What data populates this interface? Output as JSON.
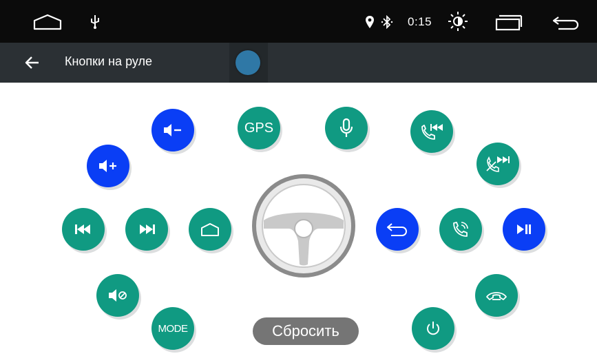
{
  "status_bar": {
    "clock": "0:15",
    "icons": [
      "home-outline-icon",
      "usb-icon",
      "location-pin-icon",
      "bluetooth-icon",
      "brightness-icon",
      "recent-apps-icon",
      "back-return-icon"
    ]
  },
  "app_bar": {
    "title": "Кнопки на руле",
    "back_icon": "arrow-left-icon"
  },
  "buttons": [
    {
      "id": "vol-down",
      "icon": "volume-down-icon",
      "color": "blue"
    },
    {
      "id": "vol-up",
      "icon": "volume-up-icon",
      "color": "blue"
    },
    {
      "id": "gps",
      "label": "GPS",
      "color": "green"
    },
    {
      "id": "mic",
      "icon": "microphone-icon",
      "color": "green"
    },
    {
      "id": "call-prev",
      "icon": "call-previous-icon",
      "color": "green"
    },
    {
      "id": "hangup-next",
      "icon": "hangup-next-icon",
      "color": "green"
    },
    {
      "id": "prev",
      "icon": "skip-previous-icon",
      "color": "green"
    },
    {
      "id": "next",
      "icon": "skip-next-icon",
      "color": "green"
    },
    {
      "id": "home",
      "icon": "home-outline-icon",
      "color": "green"
    },
    {
      "id": "back",
      "icon": "back-return-icon",
      "color": "blue"
    },
    {
      "id": "call",
      "icon": "phone-call-icon",
      "color": "green"
    },
    {
      "id": "play-pause",
      "icon": "play-pause-icon",
      "color": "blue"
    },
    {
      "id": "mute",
      "icon": "mute-icon",
      "color": "green"
    },
    {
      "id": "hangup",
      "icon": "hangup-icon",
      "color": "green"
    },
    {
      "id": "mode",
      "label": "MODE",
      "color": "green"
    },
    {
      "id": "power",
      "icon": "power-icon",
      "color": "green"
    }
  ],
  "reset_label": "Сбросить",
  "colors": {
    "green": "#109a82",
    "blue": "#0a3ef5",
    "statusbar": "#0b0b0b",
    "appbar": "#2b3034",
    "reset": "#757575"
  }
}
